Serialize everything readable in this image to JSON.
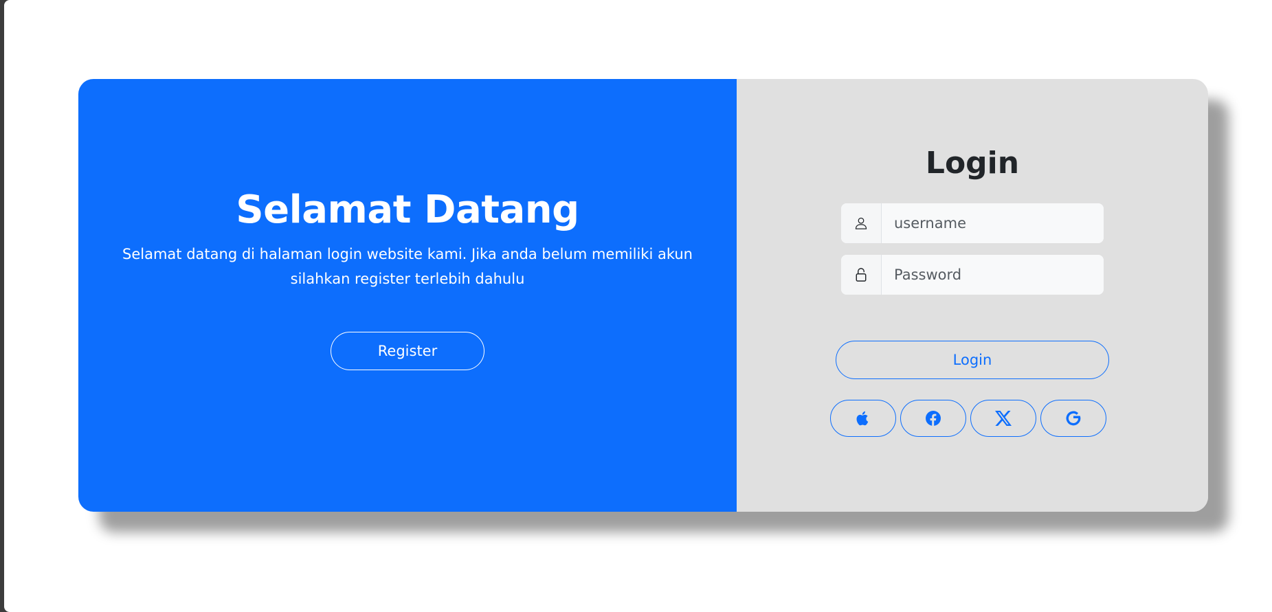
{
  "welcome": {
    "title": "Selamat Datang",
    "description": "Selamat datang di halaman login website kami. Jika anda belum memiliki akun silahkan register terlebih dahulu",
    "register_label": "Register"
  },
  "login": {
    "title": "Login",
    "username_placeholder": "username",
    "password_placeholder": "Password",
    "submit_label": "Login",
    "username_icon": "person-icon",
    "password_icon": "lock-icon"
  },
  "social": [
    {
      "icon": "apple-icon"
    },
    {
      "icon": "facebook-icon"
    },
    {
      "icon": "x-twitter-icon"
    },
    {
      "icon": "google-icon"
    }
  ],
  "colors": {
    "primary": "#0d6efd",
    "panel_gray": "#e0e0e0",
    "text_dark": "#212529",
    "white": "#ffffff"
  }
}
